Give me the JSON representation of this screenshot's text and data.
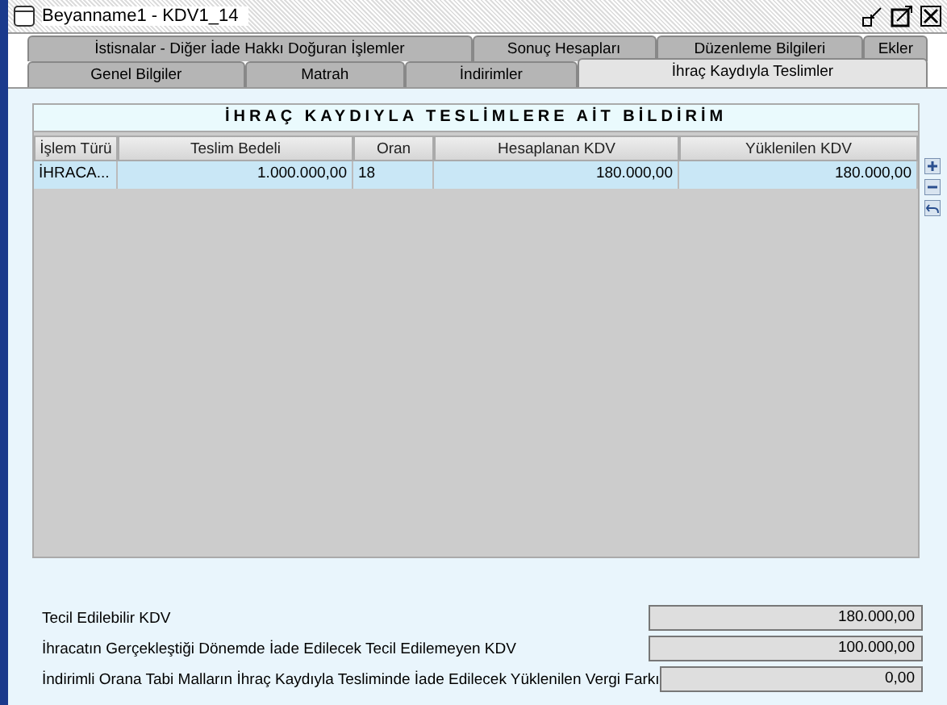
{
  "window": {
    "title": "Beyanname1 - KDV1_14"
  },
  "tab_rows": [
    [
      {
        "label": "İstisnalar - Diğer İade Hakkı Doğuran İşlemler",
        "selected": false
      },
      {
        "label": "Sonuç Hesapları",
        "selected": false
      },
      {
        "label": "Düzenleme Bilgileri",
        "selected": false
      },
      {
        "label": "Ekler",
        "selected": false
      }
    ],
    [
      {
        "label": "Genel Bilgiler",
        "selected": false
      },
      {
        "label": "Matrah",
        "selected": false
      },
      {
        "label": "İndirimler",
        "selected": false
      },
      {
        "label": "İhraç Kaydıyla Teslimler",
        "selected": true
      }
    ]
  ],
  "table": {
    "title": "İHRAÇ KAYDIYLA TESLİMLERE AİT BİLDİRİM",
    "columns": [
      "İşlem Türü",
      "Teslim Bedeli",
      "Oran",
      "Hesaplanan KDV",
      "Yüklenilen KDV"
    ],
    "rows": [
      {
        "cells": [
          "İHRACA...",
          "1.000.000,00",
          "18",
          "180.000,00",
          "180.000,00"
        ],
        "selected": true
      }
    ]
  },
  "summary": [
    {
      "label": "Tecil Edilebilir KDV",
      "value": "180.000,00"
    },
    {
      "label": "İhracatın Gerçekleştiği Dönemde İade Edilecek Tecil Edilemeyen KDV",
      "value": "100.000,00"
    },
    {
      "label": "İndirimli Orana Tabi Malların İhraç Kaydıyla Tesliminde İade Edilecek Yüklenilen Vergi Farkı",
      "value": "0,00"
    }
  ]
}
